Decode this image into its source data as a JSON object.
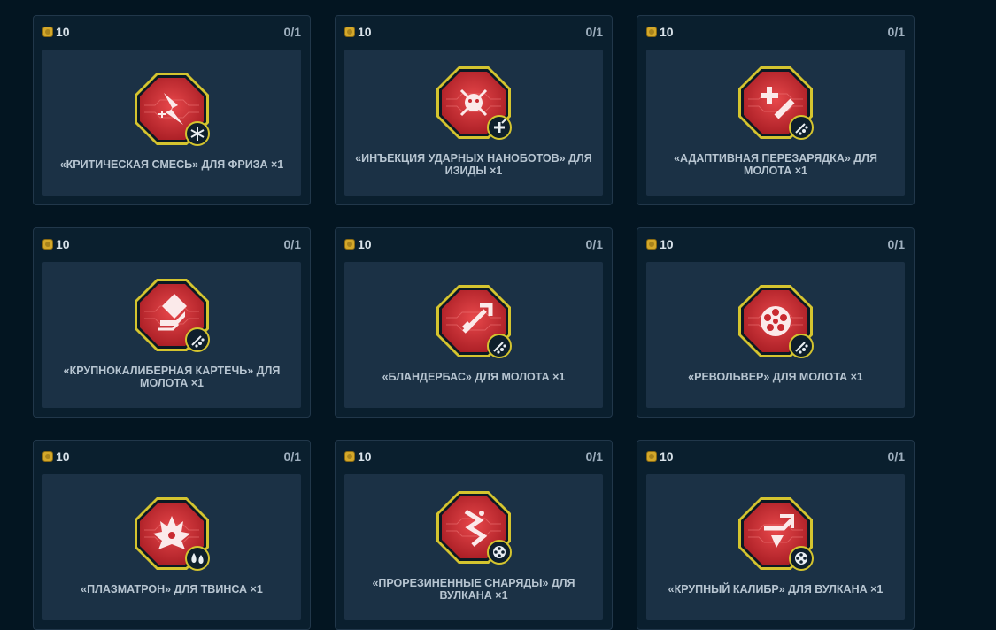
{
  "colors": {
    "background": "#031521",
    "card_bg": "#0a1f2e",
    "panel_bg": "#1b3145",
    "badge_red": "#d62f34",
    "badge_border": "#d4c42f",
    "coin": "#d4a82a"
  },
  "cards": [
    {
      "price": "10",
      "counter": "0/1",
      "title": "«КРИТИЧЕСКАЯ СМЕСЬ» ДЛЯ ФРИЗА ×1",
      "icon": "lightning-plus-icon",
      "class_icon": "snowflake-icon"
    },
    {
      "price": "10",
      "counter": "0/1",
      "title": "«ИНЪЕКЦИЯ УДАРНЫХ НАНОБОТОВ» ДЛЯ ИЗИДЫ ×1",
      "icon": "nanobot-icon",
      "class_icon": "medic-cross-icon"
    },
    {
      "price": "10",
      "counter": "0/1",
      "title": "«АДАПТИВНАЯ ПЕРЕЗАРЯДКА» ДЛЯ МОЛОТА ×1",
      "icon": "plus-slash-icon",
      "class_icon": "shotgun-pellets-icon"
    },
    {
      "price": "10",
      "counter": "0/1",
      "title": "«КРУПНОКАЛИБЕРНАЯ КАРТЕЧЬ» ДЛЯ МОЛОТА ×1",
      "icon": "heavy-shell-icon",
      "class_icon": "shotgun-pellets-icon"
    },
    {
      "price": "10",
      "counter": "0/1",
      "title": "«БЛАНДЕРБАС» ДЛЯ МОЛОТА ×1",
      "icon": "blunderbuss-icon",
      "class_icon": "shotgun-pellets-icon"
    },
    {
      "price": "10",
      "counter": "0/1",
      "title": "«РЕВОЛЬВЕР» ДЛЯ МОЛОТА ×1",
      "icon": "revolver-cylinder-icon",
      "class_icon": "shotgun-pellets-icon"
    },
    {
      "price": "10",
      "counter": "0/1",
      "title": "«ПЛАЗМАТРОН» ДЛЯ ТВИНСА ×1",
      "icon": "plasma-burst-icon",
      "class_icon": "twin-drops-icon"
    },
    {
      "price": "10",
      "counter": "0/1",
      "title": "«ПРОРЕЗИНЕННЫЕ СНАРЯДЫ» ДЛЯ ВУЛКАНА ×1",
      "icon": "rubber-shell-icon",
      "class_icon": "gatling-icon"
    },
    {
      "price": "10",
      "counter": "0/1",
      "title": "«КРУПНЫЙ КАЛИБР» ДЛЯ ВУЛКАНА ×1",
      "icon": "big-caliber-icon",
      "class_icon": "gatling-icon"
    }
  ]
}
